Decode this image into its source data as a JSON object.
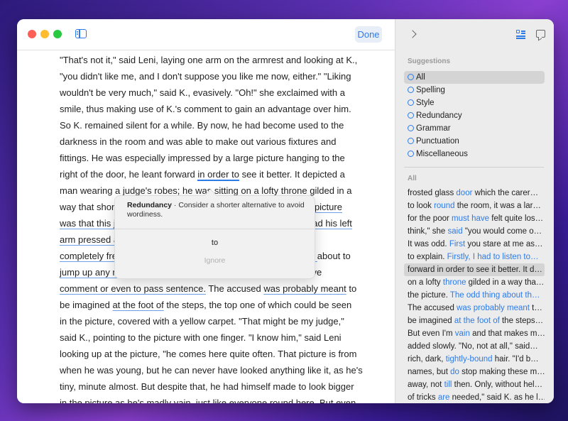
{
  "toolbar": {
    "done_label": "Done"
  },
  "document": {
    "lines": [
      [
        {
          "t": "\"That's not it,\" said Leni, laying one arm on the armrest and looking at K.,"
        }
      ],
      [
        {
          "t": "\"you didn't like me, and I don't suppose you like me now, either.\" \"Liking"
        }
      ],
      [
        {
          "t": "wouldn't be very much,\" said K., evasively. \"Oh!\" she exclaimed with a"
        }
      ],
      [
        {
          "t": "smile, thus making use of K.'s comment to gain an advantage over him."
        }
      ],
      [
        {
          "t": "So K. remained silent for a while. By now, he had become used to the"
        }
      ],
      [
        {
          "t": "darkness in the room and was able to make out various fixtures and"
        }
      ],
      [
        {
          "t": "fittings. He was especially impressed by a large picture hanging to the"
        }
      ],
      [
        {
          "t": "right of the door, he leant forward "
        },
        {
          "t": "in order to",
          "c": "hl"
        },
        {
          "t": " see it better. It depicted a"
        }
      ],
      [
        {
          "t": "man wearing a judge's robes; he was sitting on a lofty throne gilded in a"
        }
      ],
      [
        {
          "t": "way that shone forth from the picture. The odd thing about the "
        },
        {
          "t": "picture",
          "c": "u"
        }
      ],
      [
        {
          "t": "was that this judge was not sitting there in dignified calm but had his left",
          "c": "u"
        }
      ],
      [
        {
          "t": "arm pressed against the back and arm-rest of the throne, was",
          "c": "u"
        }
      ],
      [
        {
          "t": "completely free and was about to jump up with some indignant ",
          "c": "u"
        },
        {
          "t": "about to"
        }
      ],
      [
        {
          "t": "jump up any moment and make some decisive remark or to ",
          "c": "u"
        },
        {
          "t": "give"
        }
      ],
      [
        {
          "t": "comment or even to pass sentence.",
          "c": "u"
        },
        {
          "t": " The accused "
        },
        {
          "t": "was probably meant",
          "c": "u"
        },
        {
          "t": " to"
        }
      ],
      [
        {
          "t": "be imagined "
        },
        {
          "t": "at the foot of",
          "c": "u"
        },
        {
          "t": " the steps, the top one of which could be seen"
        }
      ],
      [
        {
          "t": "in the picture, covered with a yellow carpet. \"That might be my judge,\""
        }
      ],
      [
        {
          "t": "said K., pointing to the picture with one finger. \"I know him,\" said Leni"
        }
      ],
      [
        {
          "t": "looking up at the picture, \"he comes here quite often. That picture is from"
        }
      ],
      [
        {
          "t": "when he was young, but he can never have looked anything like it, as he's"
        }
      ],
      [
        {
          "t": "tiny, minute almost. But despite that, he had himself made to look bigger"
        }
      ],
      [
        {
          "t": "in the picture as he's madly vain, just like everyone round here. But even"
        }
      ]
    ]
  },
  "popover": {
    "title": "Redundancy",
    "message": " · Consider a shorter alternative to avoid wordiness.",
    "replacement": "to",
    "ignore_label": "Ignore"
  },
  "sidebar": {
    "suggestions_header": "Suggestions",
    "filters": [
      {
        "label": "All",
        "active": true
      },
      {
        "label": "Spelling"
      },
      {
        "label": "Style"
      },
      {
        "label": "Redundancy"
      },
      {
        "label": "Grammar"
      },
      {
        "label": "Punctuation"
      },
      {
        "label": "Miscellaneous"
      }
    ],
    "all_header": "All",
    "items": [
      [
        {
          "t": "frosted glass "
        },
        {
          "t": "door",
          "b": 1
        },
        {
          "t": " which the carer…"
        }
      ],
      [
        {
          "t": "to look "
        },
        {
          "t": "round",
          "b": 1
        },
        {
          "t": " the room, it was a lar…"
        }
      ],
      [
        {
          "t": "for the poor "
        },
        {
          "t": "must have",
          "b": 1
        },
        {
          "t": " felt quite los…"
        }
      ],
      [
        {
          "t": "think,\" she "
        },
        {
          "t": "said",
          "b": 1
        },
        {
          "t": " \"you would come o…"
        }
      ],
      [
        {
          "t": "It was odd. "
        },
        {
          "t": "First",
          "b": 1
        },
        {
          "t": " you stare at me as…"
        }
      ],
      [
        {
          "t": "to explain. "
        },
        {
          "t": "Firstly, I had to listen to…",
          "b": 1
        }
      ],
      [
        {
          "t": "forward in order to see it better. It d…"
        }
      ],
      [
        {
          "t": "on a lofty "
        },
        {
          "t": "throne",
          "b": 1
        },
        {
          "t": " gilded in a way tha…"
        }
      ],
      [
        {
          "t": "the picture. "
        },
        {
          "t": "The odd thing about th…",
          "b": 1
        }
      ],
      [
        {
          "t": "The accused "
        },
        {
          "t": "was probably meant",
          "b": 1
        },
        {
          "t": " t…"
        }
      ],
      [
        {
          "t": "be imagined "
        },
        {
          "t": "at the foot of",
          "b": 1
        },
        {
          "t": " the steps…"
        }
      ],
      [
        {
          "t": "But even I'm "
        },
        {
          "t": "vain",
          "b": 1
        },
        {
          "t": " and that makes m…"
        }
      ],
      [
        {
          "t": "added slowly. \"No, not at all,\" said…"
        }
      ],
      [
        {
          "t": "rich, dark, "
        },
        {
          "t": "tightly-bound",
          "b": 1
        },
        {
          "t": " hair. \"I'd b…"
        }
      ],
      [
        {
          "t": "names, but "
        },
        {
          "t": "do",
          "b": 1
        },
        {
          "t": " stop making these m…"
        }
      ],
      [
        {
          "t": "away, not "
        },
        {
          "t": "till",
          "b": 1
        },
        {
          "t": " then. Only, without hel…"
        }
      ],
      [
        {
          "t": "of tricks "
        },
        {
          "t": "are",
          "b": 1
        },
        {
          "t": " needed,\" said K. as he l…"
        }
      ]
    ],
    "active_item": 6
  }
}
